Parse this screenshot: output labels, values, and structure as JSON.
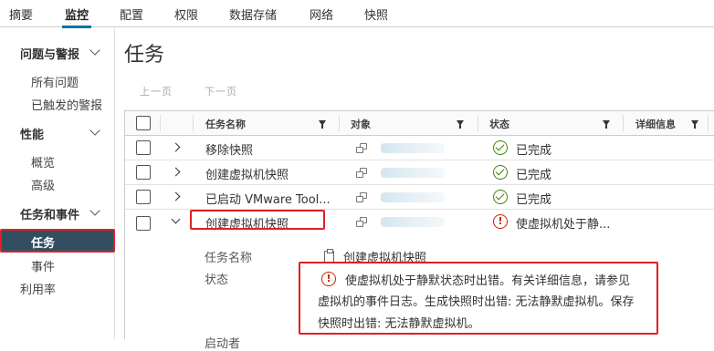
{
  "top_tabs": [
    "摘要",
    "监控",
    "配置",
    "权限",
    "数据存储",
    "网络",
    "快照"
  ],
  "active_tab": "监控",
  "sidebar": {
    "sections": [
      {
        "label": "问题与警报",
        "items": [
          "所有问题",
          "已触发的警报"
        ]
      },
      {
        "label": "性能",
        "items": [
          "概览",
          "高级"
        ]
      },
      {
        "label": "任务和事件",
        "items": [
          "任务",
          "事件"
        ]
      }
    ],
    "active_item": "任务",
    "bottom_item": "利用率"
  },
  "page_title": "任务",
  "pager": {
    "prev": "上一页",
    "next": "下一页"
  },
  "table": {
    "columns": [
      "任务名称",
      "对象",
      "状态",
      "详细信息"
    ],
    "rows": [
      {
        "name": "移除快照",
        "status": "已完成",
        "status_kind": "ok"
      },
      {
        "name": "创建虚拟机快照",
        "status": "已完成",
        "status_kind": "ok"
      },
      {
        "name": "已启动 VMware Tool...",
        "status": "已完成",
        "status_kind": "ok"
      },
      {
        "name": "创建虚拟机快照",
        "status": "使虚拟机处于静...",
        "status_kind": "error"
      }
    ]
  },
  "detail": {
    "name_label": "任务名称",
    "name_value": "创建虚拟机快照",
    "status_label": "状态",
    "status_lines": [
      "使虚拟机处于静默状态时出错。有关详细信息，请参见",
      "虚拟机的事件日志。生成快照时出错: 无法静默虚拟机。保存",
      "快照时出错: 无法静默虚拟机。"
    ],
    "cut_label": "启动者"
  },
  "icons": {
    "ok": "check-circle-icon",
    "error": "exclamation-circle-icon",
    "filter": "filter-icon",
    "vm": "vm-icon"
  },
  "colors": {
    "accent": "#0072a3",
    "active_bg": "#324f61",
    "highlight": "#e02020",
    "ok": "#3c8500",
    "error": "#c92100"
  }
}
